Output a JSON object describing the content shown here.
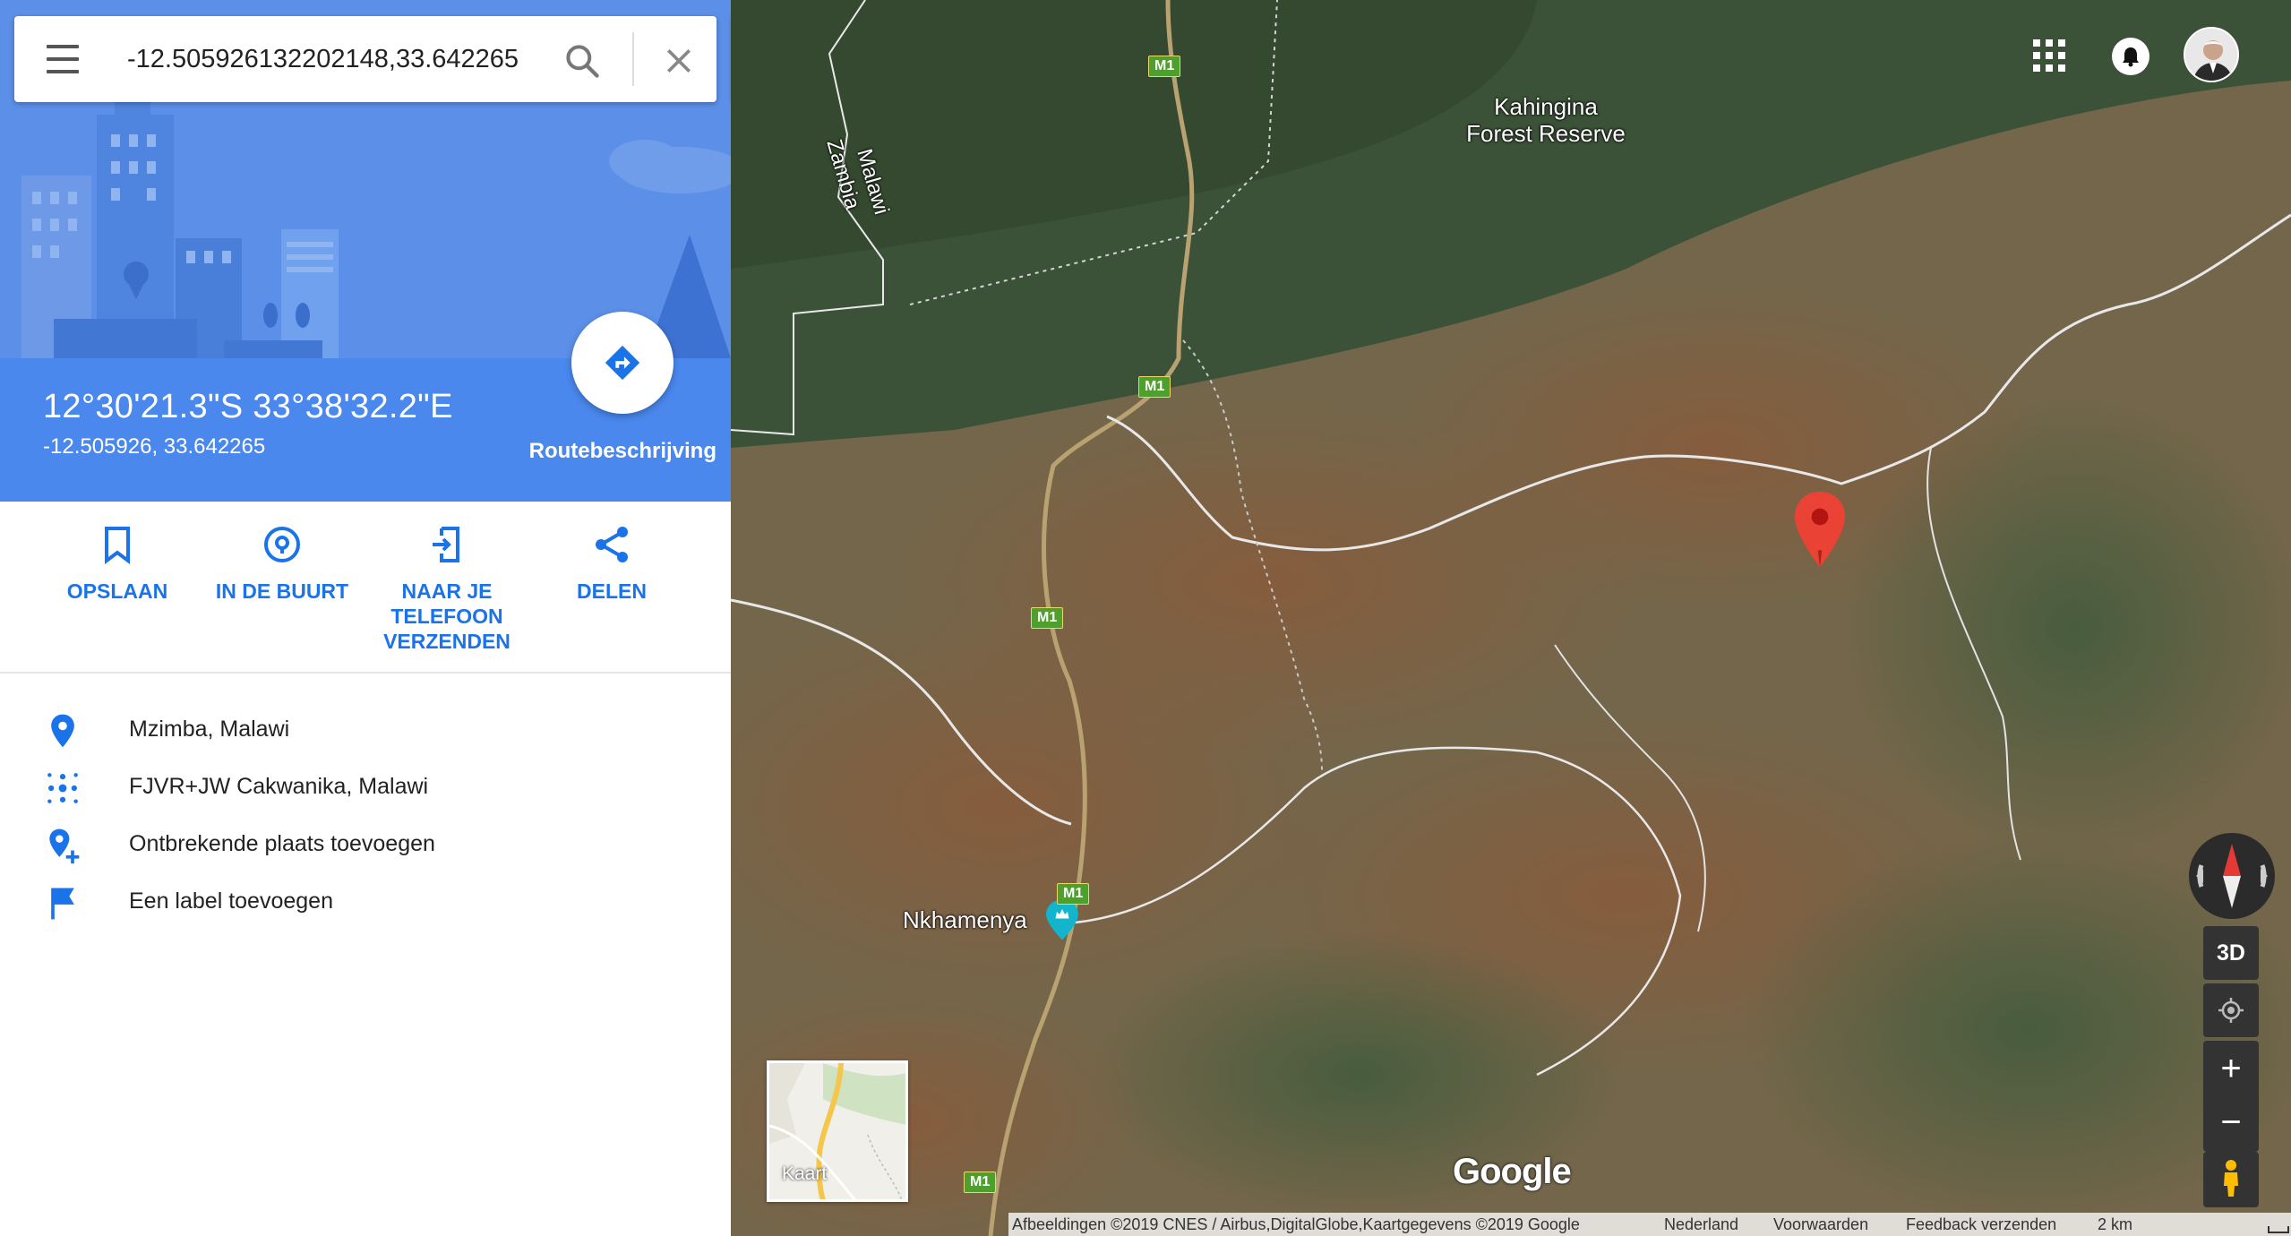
{
  "search": {
    "value": "-12.505926132202148,33.642265"
  },
  "place": {
    "title": "12°30'21.3\"S 33°38'32.2\"E",
    "subtitle": "-12.505926, 33.642265",
    "route_label": "Routebeschrijving"
  },
  "actions": [
    {
      "label": "OPSLAAN",
      "icon": "bookmark-icon"
    },
    {
      "label": "IN DE BUURT",
      "icon": "nearby-icon"
    },
    {
      "label": "NAAR JE TELEFOON VERZENDEN",
      "icon": "send-to-phone-icon"
    },
    {
      "label": "DELEN",
      "icon": "share-icon"
    }
  ],
  "info": [
    {
      "text": "Mzimba, Malawi",
      "icon": "location-pin-icon"
    },
    {
      "text": "FJVR+JW Cakwanika, Malawi",
      "icon": "plus-code-icon"
    },
    {
      "text": "Ontbrekende plaats toevoegen",
      "icon": "add-place-icon"
    },
    {
      "text": "Een label toevoegen",
      "icon": "flag-icon"
    }
  ],
  "map": {
    "labels": {
      "forest": "Kahingina\nForest Reserve",
      "malawi": "Malawi",
      "zambia": "Zambia",
      "town": "Nkhamenya"
    },
    "road_shield": "M1",
    "controls": {
      "three_d": "3D",
      "zoom_in": "+",
      "zoom_out": "−"
    },
    "minimap_label": "Kaart",
    "logo": "Google",
    "marker_color": "#ea4335"
  },
  "footer": {
    "attribution": "Afbeeldingen ©2019 CNES / Airbus,DigitalGlobe,Kaartgegevens ©2019 Google",
    "country": "Nederland",
    "terms": "Voorwaarden",
    "feedback": "Feedback verzenden",
    "scale": "2 km"
  },
  "colors": {
    "accent": "#1a73e8",
    "header_blue": "#4a88ee"
  }
}
